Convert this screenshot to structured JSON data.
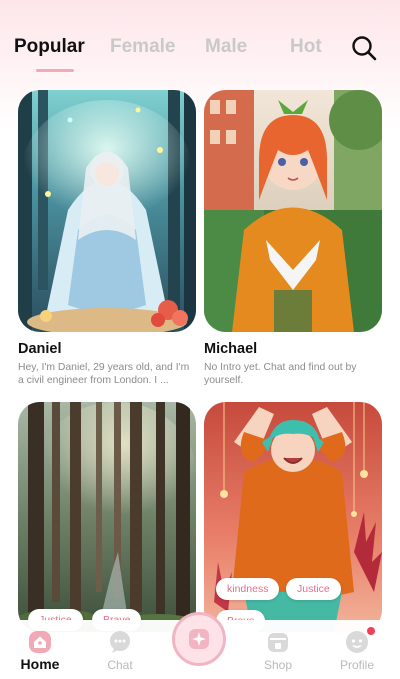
{
  "tabs": [
    {
      "label": "Popular",
      "active": true
    },
    {
      "label": "Female",
      "active": false
    },
    {
      "label": "Male",
      "active": false
    },
    {
      "label": "Hot",
      "active": false
    }
  ],
  "search_icon": "search-icon",
  "cards": [
    {
      "name": "Daniel",
      "desc": "Hey, I'm Daniel, 29 years old, and I'm a civil engineer from London. I ...",
      "image": "enchanted-forest-girl-illustration"
    },
    {
      "name": "Michael",
      "desc": "No Intro yet. Chat and find out by yourself.",
      "image": "orange-hair-schoolgirl-illustration"
    },
    {
      "name": "",
      "desc": "",
      "image": "misty-forest-illustration",
      "tags": [
        "Justice",
        "Brave"
      ]
    },
    {
      "name": "",
      "desc": "",
      "image": "mermaid-girl-illustration",
      "tags": [
        "kindness",
        "Justice",
        "Brave"
      ]
    }
  ],
  "nav": {
    "items": [
      {
        "label": "Home",
        "icon": "home-icon",
        "active": true
      },
      {
        "label": "Chat",
        "icon": "chat-icon",
        "active": false
      },
      {
        "label": "Shop",
        "icon": "shop-icon",
        "active": false
      },
      {
        "label": "Profile",
        "icon": "profile-icon",
        "active": false
      }
    ],
    "center_icon": "sparkle-create-icon"
  },
  "colors": {
    "accent": "#f0a9b6",
    "tag_text": "#e46e8c",
    "badge": "#f04055"
  }
}
